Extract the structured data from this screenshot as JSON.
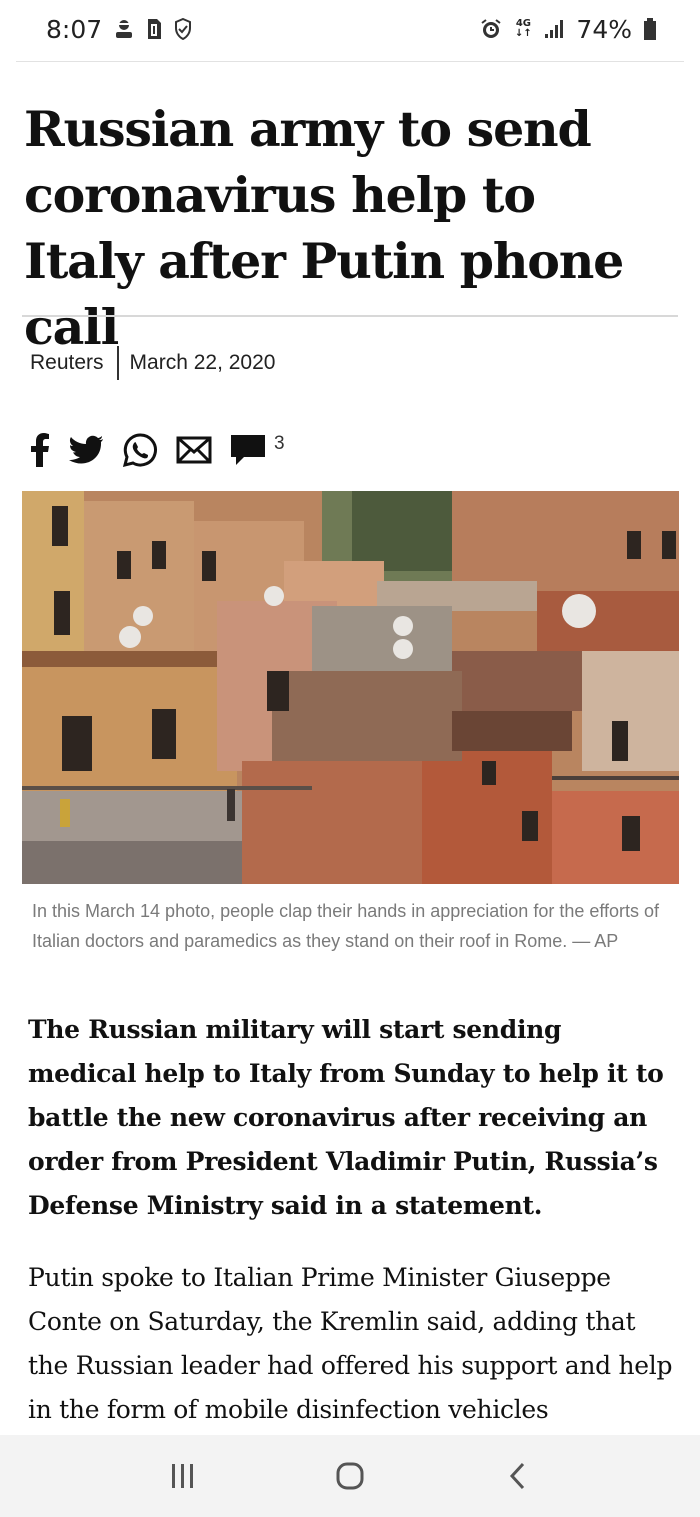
{
  "status_bar": {
    "time": "8:07",
    "left_icons": [
      "avatar-icon",
      "sim-card-icon",
      "shield-check-icon"
    ],
    "network": "4G",
    "battery": "74%",
    "right_icons": [
      "alarm-icon",
      "network-4g-icon",
      "signal-icon",
      "battery-icon"
    ]
  },
  "article": {
    "headline": "Russian army to send coronavirus help to Italy after Putin phone call",
    "source": "Reuters",
    "date": "March 22, 2020",
    "share_icons": [
      "facebook-icon",
      "twitter-icon",
      "whatsapp-icon",
      "email-icon",
      "comment-icon"
    ],
    "comment_count": "3",
    "caption": "In this March 14 photo, people clap their hands in appreciation for the efforts of Italian doctors and paramedics as they stand on their roof in Rome. — AP",
    "lede": "The Russian military will start sending medical help to Italy from Sunday to help it to battle the new coronavirus after receiving an order from President Vladimir Putin, Russia’s Defense Ministry said in a statement.",
    "body": "Putin spoke to Italian Prime Minister Giuseppe Conte on Saturday, the Kremlin said, adding that the Russian leader had offered his support and help in the form of mobile disinfection vehicles"
  },
  "nav_bar": {
    "icons": [
      "recent-apps-icon",
      "home-icon",
      "back-icon"
    ]
  },
  "colors": {
    "text": "#111111",
    "caption": "#7a7a7a",
    "navbar_bg": "#f3f3f3"
  }
}
